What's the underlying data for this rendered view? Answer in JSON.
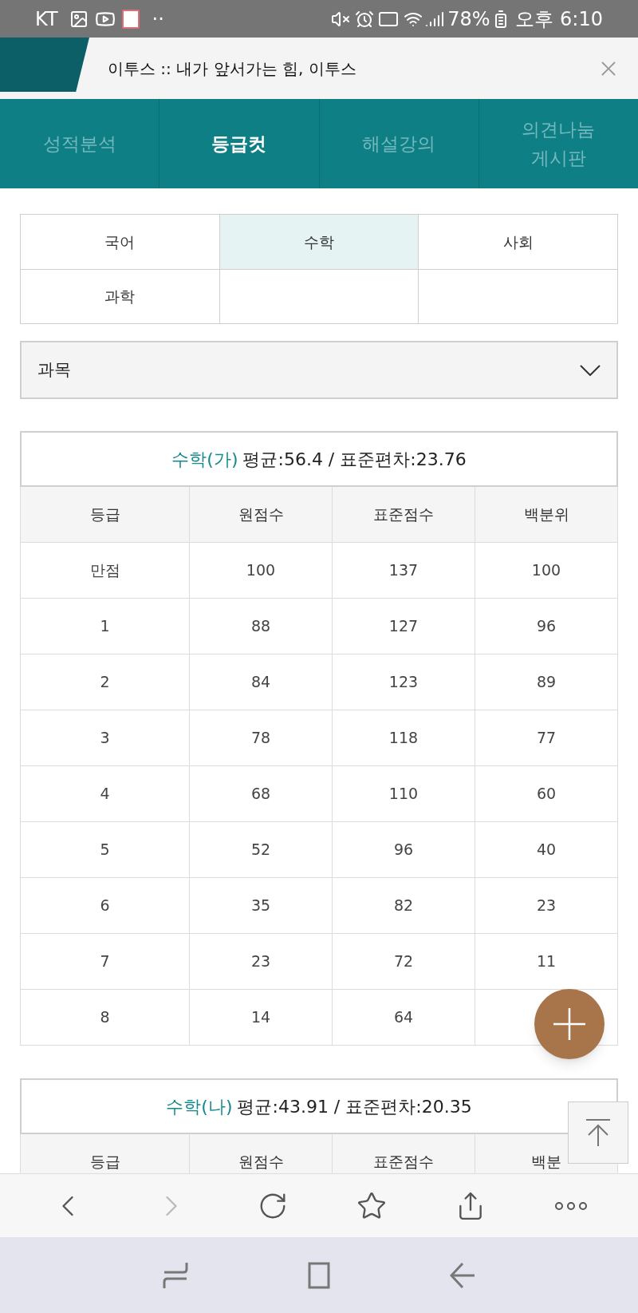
{
  "status_bar": {
    "carrier": "KT",
    "dots": "··",
    "battery": "78%",
    "time": "오후 6:10"
  },
  "tab_title": {
    "title": "이투스 :: 내가 앞서가는 힘, 이투스"
  },
  "nav_tabs": [
    {
      "label": "성적분석",
      "selected": false
    },
    {
      "label": "등급컷",
      "selected": true
    },
    {
      "label": "해설강의",
      "selected": false
    },
    {
      "label": "의견나눔\n게시판",
      "selected": false
    }
  ],
  "subjects": [
    {
      "label": "국어",
      "selected": false
    },
    {
      "label": "수학",
      "selected": true
    },
    {
      "label": "사회",
      "selected": false
    },
    {
      "label": "과학",
      "selected": false
    }
  ],
  "dropdown": {
    "label": "과목"
  },
  "tables": [
    {
      "subject": "수학(가)",
      "stats": "평균:56.4 / 표준편차:23.76",
      "columns": [
        "등급",
        "원점수",
        "표준점수",
        "백분위"
      ],
      "rows": [
        [
          "만점",
          "100",
          "137",
          "100"
        ],
        [
          "1",
          "88",
          "127",
          "96"
        ],
        [
          "2",
          "84",
          "123",
          "89"
        ],
        [
          "3",
          "78",
          "118",
          "77"
        ],
        [
          "4",
          "68",
          "110",
          "60"
        ],
        [
          "5",
          "52",
          "96",
          "40"
        ],
        [
          "6",
          "35",
          "82",
          "23"
        ],
        [
          "7",
          "23",
          "72",
          "11"
        ],
        [
          "8",
          "14",
          "64"
        ]
      ]
    },
    {
      "subject": "수학(나)",
      "stats": "평균:43.91 / 표준편차:20.35",
      "columns": [
        "등급",
        "원점수",
        "표준점수",
        "백분"
      ]
    }
  ]
}
